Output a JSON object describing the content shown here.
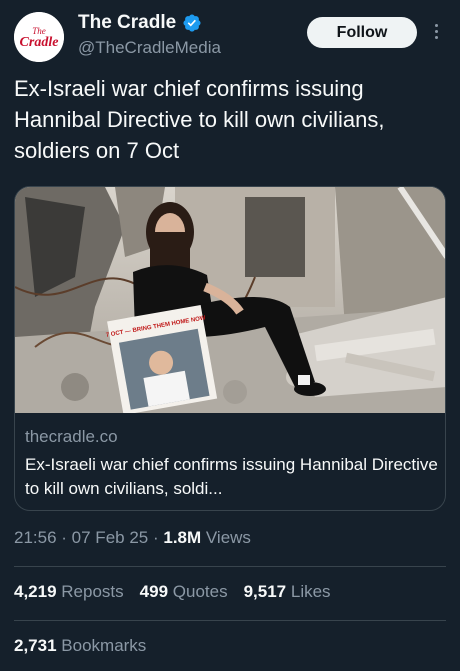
{
  "author": {
    "name": "The Cradle",
    "handle": "@TheCradleMedia",
    "avatar_logo_text": "The Cradle",
    "verified": true
  },
  "follow_label": "Follow",
  "tweet_text": "Ex-Israeli war chief confirms issuing Hannibal Directive to kill own civilians, soldiers on 7 Oct",
  "card": {
    "poster_text": "7 OCT — BRING THEM HOME NOW",
    "domain": "thecradle.co",
    "title": "Ex-Israeli war chief confirms issuing Hannibal Directive to kill own civilians, soldi..."
  },
  "meta": {
    "time": "21:56",
    "date": "07 Feb 25",
    "views_count": "1.8M",
    "views_label": "Views"
  },
  "stats": {
    "reposts_count": "4,219",
    "reposts_label": "Reposts",
    "quotes_count": "499",
    "quotes_label": "Quotes",
    "likes_count": "9,517",
    "likes_label": "Likes",
    "bookmarks_count": "2,731",
    "bookmarks_label": "Bookmarks"
  },
  "colors": {
    "background": "#15202b",
    "text": "#f7f9f9",
    "muted": "#8b98a5",
    "border": "#38444d",
    "verified": "#1d9bf0",
    "logo": "#c8102e"
  }
}
